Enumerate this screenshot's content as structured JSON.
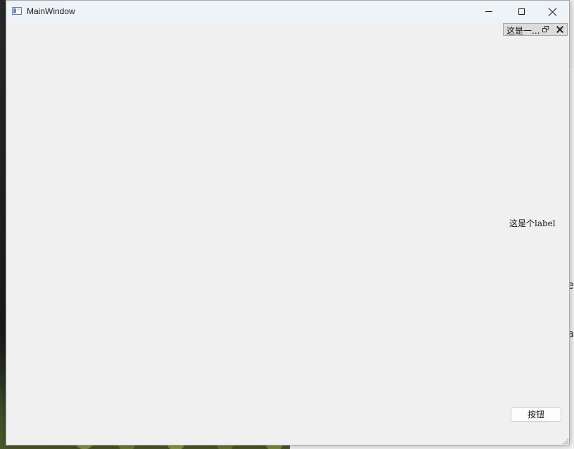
{
  "window": {
    "title": "MainWindow",
    "icon": "app-window-icon",
    "controls": {
      "minimize_icon": "minimize-icon",
      "maximize_icon": "maximize-icon",
      "close_icon": "close-icon"
    }
  },
  "dock": {
    "title": "这是一...",
    "float_icon": "float-dock-icon",
    "close_icon": "close-dock-icon",
    "label": "这是个label",
    "button_label": "按钮"
  },
  "background": {
    "partial_glyphs": [
      "e",
      "a"
    ]
  },
  "colors": {
    "titlebar": "#eef3f8",
    "client": "#f0f0f0",
    "dock_title_bar": "#dcdcdc",
    "button_background": "#fdfdfd"
  }
}
